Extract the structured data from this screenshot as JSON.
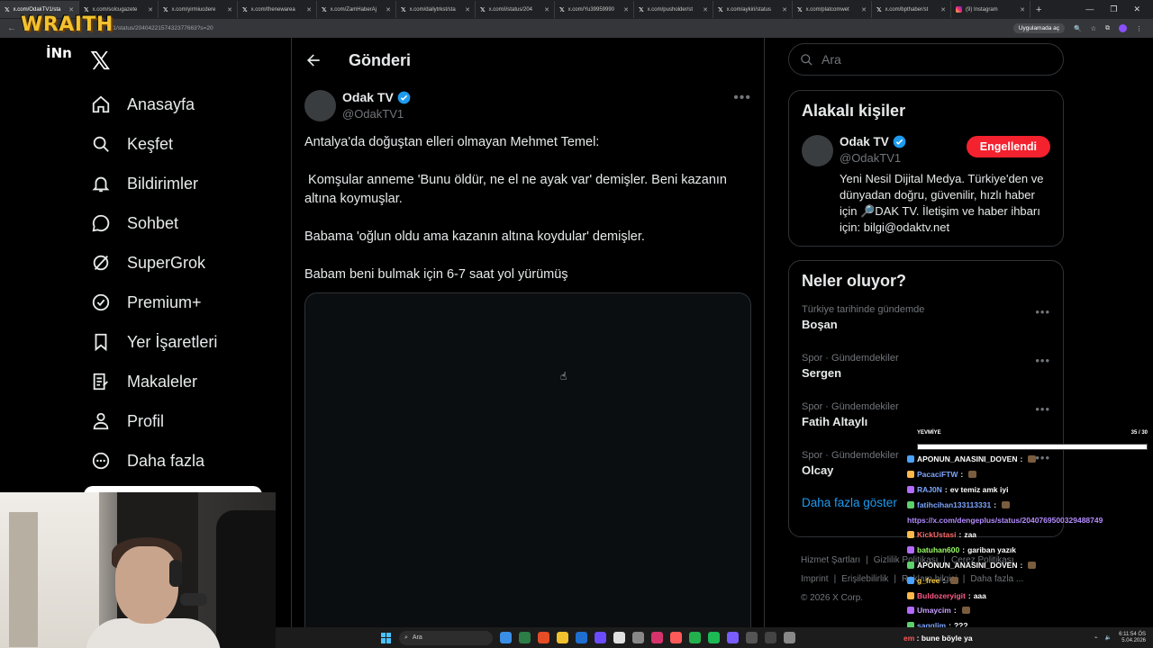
{
  "overlay": {
    "brand": "WRAITH",
    "inn_logo": "İNn"
  },
  "browser": {
    "tabs": [
      {
        "label": "x.com/OdakTV1/sta",
        "active": true
      },
      {
        "label": "x.com/solcugazete"
      },
      {
        "label": "x.com/yirmiucdere"
      },
      {
        "label": "x.com/thenewarea"
      },
      {
        "label": "x.com/ZamHaberAj"
      },
      {
        "label": "x.com/dailytrkst/sta"
      },
      {
        "label": "x.com/i/status/204"
      },
      {
        "label": "x.com/Yu39959990"
      },
      {
        "label": "x.com/pusholder/st"
      },
      {
        "label": "x.com/aykiri/status"
      },
      {
        "label": "x.com/platcomwet"
      },
      {
        "label": "x.com/bpthaber/st"
      },
      {
        "label": "(9) Instagram",
        "instagram": true
      }
    ],
    "url": "3/1/status/2040422157432377663?s=20",
    "open_in_app": "Uygulamada aç"
  },
  "nav": {
    "items": [
      {
        "label": "Anasayfa",
        "icon": "home-icon"
      },
      {
        "label": "Keşfet",
        "icon": "search-icon"
      },
      {
        "label": "Bildirimler",
        "icon": "bell-icon"
      },
      {
        "label": "Sohbet",
        "icon": "chat-icon"
      },
      {
        "label": "SuperGrok",
        "icon": "grok-icon"
      },
      {
        "label": "Premium+",
        "icon": "verified-badge-icon"
      },
      {
        "label": "Yer İşaretleri",
        "icon": "bookmark-icon"
      },
      {
        "label": "Makaleler",
        "icon": "article-icon"
      },
      {
        "label": "Profil",
        "icon": "profile-icon"
      },
      {
        "label": "Daha fazla",
        "icon": "more-circle-icon"
      }
    ]
  },
  "main": {
    "title": "Gönderi",
    "post": {
      "author_name": "Odak TV",
      "author_handle": "@OdakTV1",
      "paragraphs": [
        "Antalya'da doğuştan elleri olmayan Mehmet Temel:",
        " Komşular anneme 'Bunu öldür, ne el ne ayak var' demişler. Beni kazanın altına koymuşlar.",
        "Babama 'oğlun oldu ama kazanın altına koydular' demişler.",
        "Babam beni bulmak için 6-7 saat yol yürümüş"
      ]
    }
  },
  "right": {
    "search_placeholder": "Ara",
    "related": {
      "title": "Alakalı kişiler",
      "name": "Odak TV",
      "handle": "@OdakTV1",
      "button": "Engellendi",
      "bio": "Yeni Nesil Dijital Medya. Türkiye'den ve dünyadan doğru, güvenilir, hızlı haber için 🔎DAK TV. İletişim ve haber ihbarı için: bilgi@odaktv.net"
    },
    "trends": {
      "title": "Neler oluyor?",
      "items": [
        {
          "meta": "Türkiye tarihinde gündemde",
          "name": "Boşan"
        },
        {
          "meta": "Spor · Gündemdekiler",
          "name": "Sergen"
        },
        {
          "meta": "Spor · Gündemdekiler",
          "name": "Fatih Altaylı"
        },
        {
          "meta": "Spor · Gündemdekiler",
          "name": "Olcay"
        }
      ],
      "show_more": "Daha fazla göster"
    },
    "footer": {
      "links_row1": [
        "Hizmet Şartları",
        "Gizlilik Politikası",
        "Çerez Politikası"
      ],
      "links_row2": [
        "Imprint",
        "Erişilebilirlik",
        "Reklam bilgisi",
        "Daha fazla ..."
      ],
      "copyright": "© 2026 X Corp."
    }
  },
  "chat": {
    "header_left": "YEVMİYE",
    "header_right": "35 / 30",
    "progress": 1.0,
    "messages": [
      {
        "user": "APONUN_ANASINI_DOVEN",
        "text": "",
        "color": "#ffffff"
      },
      {
        "user": "PacaciFTW",
        "text": "",
        "color": "#7ea6ff"
      },
      {
        "user": "RAJ0N",
        "text": "ev temiz amk iyi",
        "color": "#7ea6ff"
      },
      {
        "user": "fatihcihan133113331",
        "text": "",
        "color": "#7ea6ff"
      },
      {
        "user": "",
        "text": "https://x.com/dengeplus/status/2040769500329488749",
        "color": "#b48cff",
        "url": true
      },
      {
        "user": "KickUstasi",
        "text": "zaa",
        "color": "#ff6b6b"
      },
      {
        "user": "batuhan600",
        "text": "gariban yazık",
        "color": "#9dff6b"
      },
      {
        "user": "APONUN_ANASINI_DOVEN",
        "text": "",
        "color": "#ffffff"
      },
      {
        "user": "g_free",
        "text": "",
        "color": "#ffd24a"
      },
      {
        "user": "Buldozeryigit",
        "text": "aaa",
        "color": "#ff5a8a"
      },
      {
        "user": "Umaycim",
        "text": "",
        "color": "#c7a0ff"
      },
      {
        "user": "sagglim",
        "text": "???",
        "color": "#7ea6ff"
      }
    ],
    "bottom_user": "em",
    "bottom_text": "bune böyle ya"
  },
  "taskbar": {
    "search": "Ara",
    "time": "6:11:54 ÖS",
    "date": "5.04.2026"
  }
}
